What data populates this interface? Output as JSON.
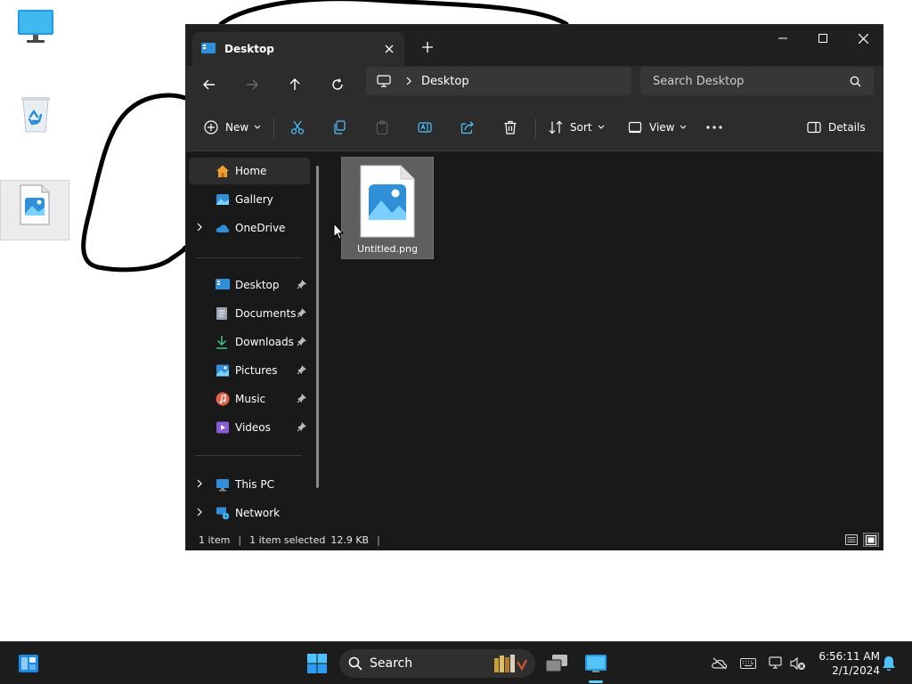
{
  "desktop": {
    "icons": [
      {
        "name": "this-pc",
        "label": ""
      },
      {
        "name": "recycle-bin",
        "label": ""
      },
      {
        "name": "untitled-png",
        "label": ""
      }
    ]
  },
  "window": {
    "tab_title": "Desktop",
    "address": {
      "crumb": "Desktop"
    },
    "search": {
      "placeholder": "Search Desktop"
    },
    "toolbar": {
      "new_label": "New",
      "sort_label": "Sort",
      "view_label": "View",
      "details_label": "Details"
    },
    "sidebar": {
      "items": [
        {
          "label": "Home"
        },
        {
          "label": "Gallery"
        },
        {
          "label": "OneDrive"
        },
        {
          "label": "Desktop"
        },
        {
          "label": "Documents"
        },
        {
          "label": "Downloads"
        },
        {
          "label": "Pictures"
        },
        {
          "label": "Music"
        },
        {
          "label": "Videos"
        },
        {
          "label": "This PC"
        },
        {
          "label": "Network"
        }
      ]
    },
    "files": [
      {
        "name": "Untitled.png"
      }
    ],
    "status": {
      "count": "1 item",
      "selected": "1 item selected",
      "size": "12.9 KB"
    }
  },
  "taskbar": {
    "search_label": "Search",
    "clock": {
      "time": "6:56:11 AM",
      "date": "2/1/2024"
    }
  },
  "colors": {
    "accent": "#60cdff",
    "window_bg": "#191919",
    "toolbar_bg": "#2c2c2c",
    "folder_blue": "#2f8fd8"
  }
}
